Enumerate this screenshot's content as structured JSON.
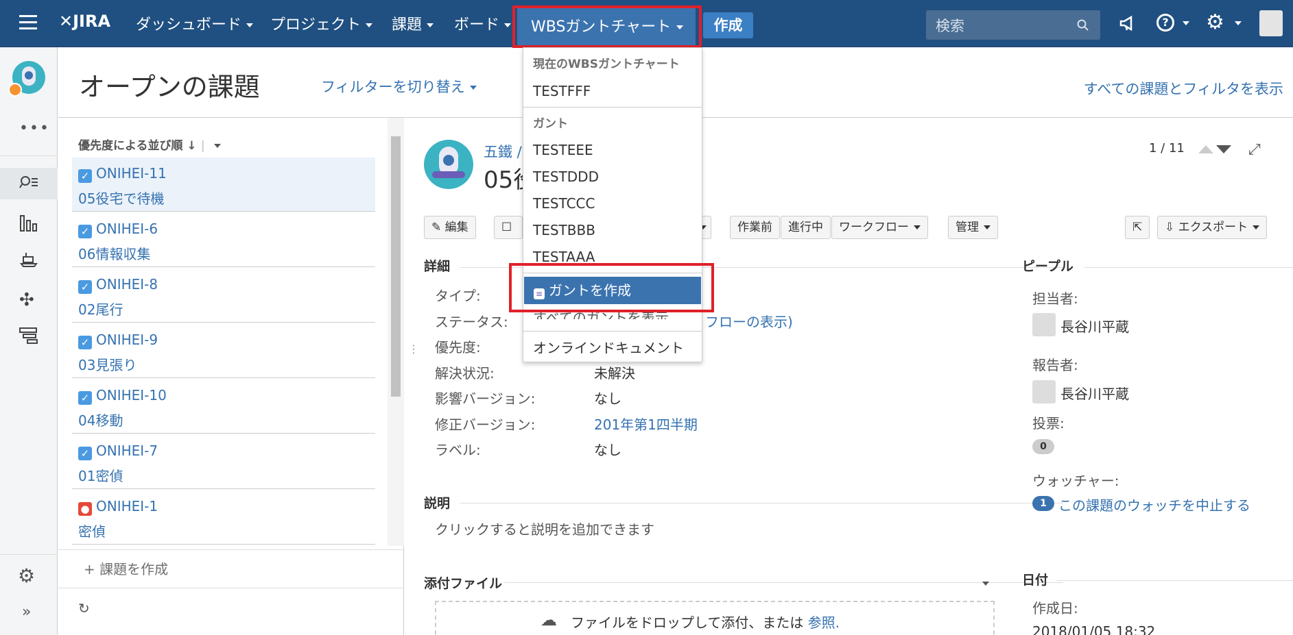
{
  "nav": {
    "logo": "JIRA",
    "items": [
      "ダッシュボード",
      "プロジェクト",
      "課題",
      "ボード"
    ],
    "wbs": "WBSガントチャート",
    "create": "作成",
    "search_placeholder": "検索"
  },
  "page": {
    "title": "オープンの課題",
    "switch_filter": "フィルターを切り替え",
    "all_issues": "すべての課題とフィルタを表示"
  },
  "list": {
    "sort_label": "優先度による並び順",
    "issues": [
      {
        "key": "ONIHEI-11",
        "summary": "05役宅で待機"
      },
      {
        "key": "ONIHEI-6",
        "summary": "06情報収集"
      },
      {
        "key": "ONIHEI-8",
        "summary": "02尾行"
      },
      {
        "key": "ONIHEI-9",
        "summary": "03見張り"
      },
      {
        "key": "ONIHEI-10",
        "summary": "04移動"
      },
      {
        "key": "ONIHEI-7",
        "summary": "01密偵"
      },
      {
        "key": "ONIHEI-1",
        "summary": "密偵"
      }
    ],
    "create_issue": "+ 課題を作成"
  },
  "detail": {
    "project": "五鐵 /",
    "title": "05役",
    "pager": "1 / 11",
    "buttons": {
      "edit": "編集",
      "before": "作業前",
      "progress": "進行中",
      "workflow": "ワークフロー",
      "admin": "管理",
      "export": "エクスポート"
    },
    "section_details": "詳細",
    "fields": [
      {
        "label": "タイプ:",
        "value": ""
      },
      {
        "label": "ステータス:",
        "value": "フローの表示)"
      },
      {
        "label": "優先度:",
        "value": ""
      },
      {
        "label": "解決状況:",
        "value": "未解決"
      },
      {
        "label": "影響バージョン:",
        "value": "なし"
      },
      {
        "label": "修正バージョン:",
        "value": "201年第1四半期"
      },
      {
        "label": "ラベル:",
        "value": "なし"
      }
    ],
    "section_desc": "説明",
    "desc_hint": "クリックすると説明を追加できます",
    "section_attach": "添付ファイル",
    "drop_text": "ファイルをドロップして添付、または",
    "drop_link": "参照.",
    "people": {
      "title": "ピープル",
      "assignee_label": "担当者:",
      "assignee": "長谷川平蔵",
      "reporter_label": "報告者:",
      "reporter": "長谷川平蔵",
      "votes_label": "投票:",
      "votes": "0",
      "watchers_label": "ウォッチャー:",
      "watch_count": "1",
      "watch_link": "この課題のウォッチを中止する"
    },
    "dates": {
      "title": "日付",
      "created_label": "作成日:",
      "created": "2018/01/05 18:32"
    }
  },
  "dropdown": {
    "current_header": "現在のWBSガントチャート",
    "current": "TESTFFF",
    "gantt_header": "ガント",
    "gantts": [
      "TESTEEE",
      "TESTDDD",
      "TESTCCC",
      "TESTBBB",
      "TESTAAA"
    ],
    "create_gantt": "ガントを作成",
    "show_all": "すべてのガントを表示",
    "online_doc": "オンラインドキュメント"
  },
  "colors": {
    "nav_bg": "#205081",
    "accent": "#3b73af",
    "highlight": "#e0202a"
  }
}
